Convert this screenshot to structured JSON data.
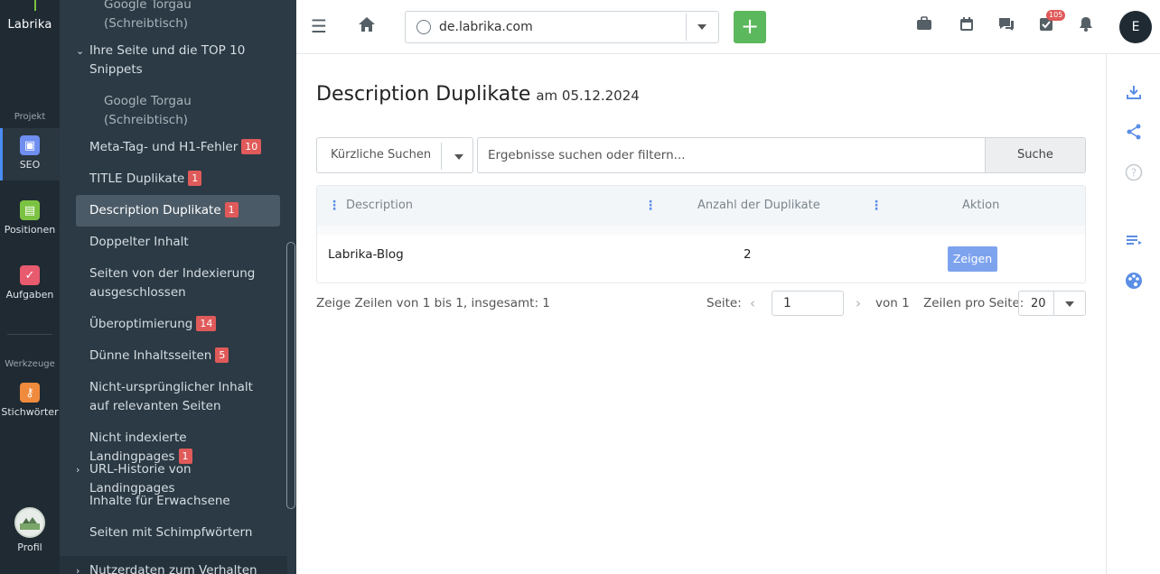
{
  "rail": {
    "logo": "Labrika",
    "section_project": "Projekt",
    "section_tools": "Werkzeuge",
    "items": [
      {
        "label": "SEO",
        "icon": "seo-icon",
        "color": "#6f8ef0"
      },
      {
        "label": "Positionen",
        "icon": "chart-icon",
        "color": "#7cc242"
      },
      {
        "label": "Aufgaben",
        "icon": "check-icon",
        "color": "#e85a6e"
      },
      {
        "label": "Stichwörter",
        "icon": "key-icon",
        "color": "#f08a3c"
      },
      {
        "label": "Profil",
        "icon": "profile-avatar"
      }
    ]
  },
  "sidebar": {
    "items": [
      {
        "label": "Google Torgau (Schreibtisch)"
      },
      {
        "label": "Ihre Seite und die TOP 10 Snippets"
      },
      {
        "label": "Google Torgau (Schreibtisch)"
      },
      {
        "label": "Meta-Tag- und H1-Fehler",
        "badge": "10"
      },
      {
        "label": "TITLE Duplikate",
        "badge": "1"
      },
      {
        "label": "Description Duplikate",
        "badge": "1"
      },
      {
        "label": "Doppelter Inhalt"
      },
      {
        "label": "Seiten von der Indexierung ausgeschlossen"
      },
      {
        "label": "Überoptimierung",
        "badge": "14"
      },
      {
        "label": "Dünne Inhaltsseiten",
        "badge": "5"
      },
      {
        "label": "Nicht-ursprünglicher Inhalt auf relevanten Seiten"
      },
      {
        "label": "Nicht indexierte Landingpages",
        "badge": "1"
      },
      {
        "label": "URL-Historie von Landingpages"
      },
      {
        "label": "Inhalte für Erwachsene"
      },
      {
        "label": "Seiten mit Schimpfwörtern"
      },
      {
        "label": "Nutzerdaten zum Verhalten"
      }
    ]
  },
  "topbar": {
    "url": "de.labrika.com",
    "add_label": "+",
    "notif_count": "105",
    "user_initial": "E"
  },
  "main": {
    "title": "Description Duplikate",
    "date": "am 05.12.2024",
    "recent_searches": "Kürzliche Suchen",
    "search_placeholder": "Ergebnisse suchen oder filtern...",
    "search_button": "Suche",
    "columns": [
      "Description",
      "Anzahl der Duplikate",
      "Aktion"
    ],
    "rows": [
      {
        "description": "Labrika-Blog",
        "count": "2",
        "action": "Zeigen"
      }
    ],
    "summary": "Zeige Zeilen von 1 bis 1, insgesamt: 1",
    "page_label": "Seite:",
    "page_value": "1",
    "page_of": "von 1",
    "rows_per_page_label": "Zeilen pro Seite:",
    "rows_per_page": "20"
  }
}
